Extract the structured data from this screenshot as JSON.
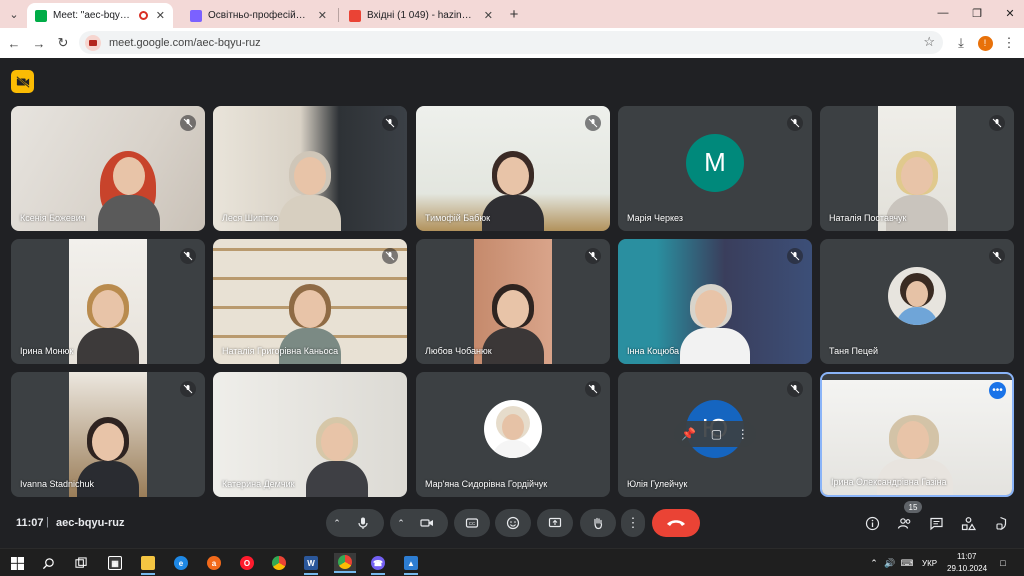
{
  "browser": {
    "tabs": [
      {
        "title": "Meet: \"aec-bqyu-ruz\"",
        "favicon_color": "#00ac47",
        "active": true,
        "recording": true
      },
      {
        "title": "Освітньо-професійна програм",
        "favicon_color": "#7b61ff",
        "active": false
      },
      {
        "title": "Вхідні (1 049) - hazina@kpnu.e",
        "favicon_color": "#ea4335",
        "active": false
      }
    ],
    "new_tab_symbol": "+",
    "url": "meet.google.com/aec-bqyu-ruz",
    "profile_initial": "!"
  },
  "meet": {
    "time": "11:07",
    "separator": "|",
    "code": "aec-bqyu-ruz",
    "people_count": "15",
    "accent_end_call": "#ea4335",
    "participants": [
      {
        "name": "Ксенія Божевич",
        "type": "video",
        "muted": true
      },
      {
        "name": "Леся Шипітко",
        "type": "video",
        "muted": true
      },
      {
        "name": "Тимофій Бабюк",
        "type": "video",
        "muted": true
      },
      {
        "name": "Марія Черкез",
        "type": "letter",
        "letter": "M",
        "avatar_color": "#00897b",
        "muted": true
      },
      {
        "name": "Наталія Поставчук",
        "type": "video",
        "muted": true
      },
      {
        "name": "Ірина Монюк",
        "type": "video",
        "muted": true
      },
      {
        "name": "Наталія Григорівна Каньоса",
        "type": "video",
        "muted": true
      },
      {
        "name": "Любов Чобанюк",
        "type": "video",
        "muted": true
      },
      {
        "name": "Інна Коцюба",
        "type": "video",
        "muted": true
      },
      {
        "name": "Таня Пецей",
        "type": "photo",
        "muted": true
      },
      {
        "name": "Ivanna Stadnichuk",
        "type": "video",
        "muted": true
      },
      {
        "name": "Катерина Демчик",
        "type": "video",
        "muted": false
      },
      {
        "name": "Мар'яна Сидорівна Гордійчук",
        "type": "photo",
        "muted": true
      },
      {
        "name": "Юлія Гулейчук",
        "type": "letter",
        "letter": "Ю",
        "avatar_color": "#1565c0",
        "muted": true
      },
      {
        "name": "Ірина Олександрівна Газіна",
        "type": "video",
        "muted": false,
        "selected": true
      }
    ]
  },
  "taskbar": {
    "language": "УКР",
    "clock_time": "11:07",
    "clock_date": "29.10.2024"
  }
}
